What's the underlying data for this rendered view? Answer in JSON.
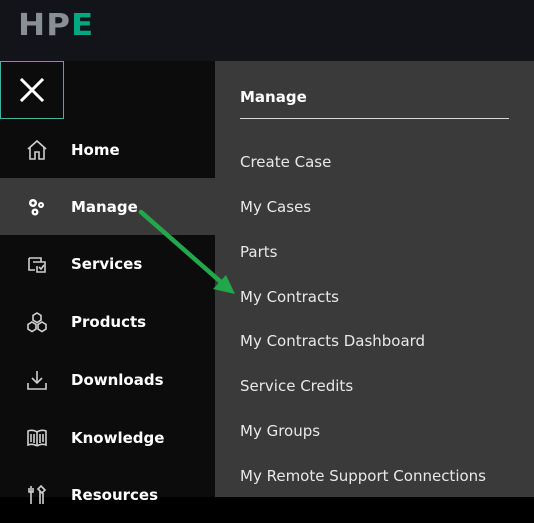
{
  "brand": {
    "logo_hp": "HP",
    "logo_e": "E"
  },
  "sidebar": {
    "close_icon": "close-icon",
    "items": [
      {
        "label": "Home",
        "icon": "home-icon"
      },
      {
        "label": "Manage",
        "icon": "gears-icon",
        "active": true
      },
      {
        "label": "Services",
        "icon": "services-icon"
      },
      {
        "label": "Products",
        "icon": "cubes-icon"
      },
      {
        "label": "Downloads",
        "icon": "download-icon"
      },
      {
        "label": "Knowledge",
        "icon": "book-icon"
      },
      {
        "label": "Resources",
        "icon": "tools-icon"
      }
    ]
  },
  "submenu": {
    "title": "Manage",
    "items": [
      {
        "label": "Create Case"
      },
      {
        "label": "My Cases"
      },
      {
        "label": "Parts"
      },
      {
        "label": "My Contracts"
      },
      {
        "label": "My Contracts Dashboard"
      },
      {
        "label": "Service Credits"
      },
      {
        "label": "My Groups"
      },
      {
        "label": "My Remote Support Connections"
      }
    ]
  },
  "colors": {
    "brand_green": "#01a982",
    "annotation_arrow": "#22a74a",
    "active_bg": "#3a3a3a",
    "close_border": "#3bb3a6"
  }
}
